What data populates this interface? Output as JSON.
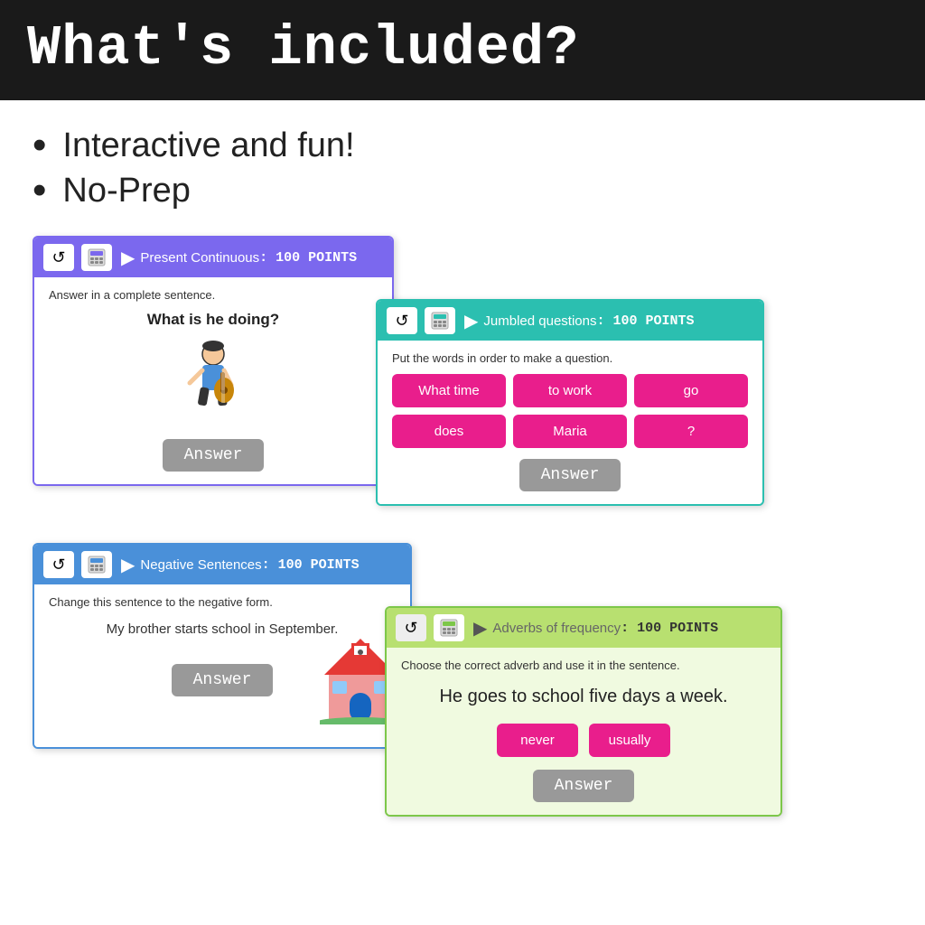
{
  "header": {
    "title": "What's included?"
  },
  "bullets": [
    "Interactive and fun!",
    "No-Prep"
  ],
  "cards": {
    "card1": {
      "title": "Present Continuous",
      "points": ": 100 POINTS",
      "instruction": "Answer in a complete sentence.",
      "question": "What is he doing?",
      "answer_btn": "Answer"
    },
    "card2": {
      "title": "Jumbled questions",
      "points": ": 100 POINTS",
      "instruction": "Put the words in order to make a question.",
      "words": [
        "What time",
        "to work",
        "go",
        "does",
        "Maria",
        "?"
      ],
      "answer_btn": "Answer"
    },
    "card3": {
      "title": "Negative Sentences",
      "points": ": 100 POINTS",
      "instruction": "Change this sentence to the negative form.",
      "sentence": "My brother starts school in September.",
      "answer_btn": "Answer"
    },
    "card4": {
      "title": "Adverbs of frequency",
      "points": ": 100 POINTS",
      "instruction": "Choose the correct adverb and use it in the sentence.",
      "sentence": "He goes to school five days a week.",
      "words": [
        "never",
        "usually"
      ],
      "answer_btn": "Answer"
    }
  }
}
